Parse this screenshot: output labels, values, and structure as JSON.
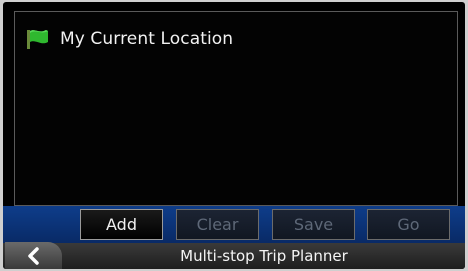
{
  "list": {
    "items": [
      {
        "label": "My Current Location",
        "icon": "green-flag-icon"
      }
    ]
  },
  "toolbar": {
    "add_label": "Add",
    "clear_label": "Clear",
    "save_label": "Save",
    "go_label": "Go"
  },
  "footer": {
    "title": "Multi-stop Trip Planner",
    "back_icon": "back-arrow-icon"
  },
  "colors": {
    "accent_bar": "#0e3d8a",
    "flag_green": "#2fb82f",
    "disabled_text": "#5e6878"
  }
}
